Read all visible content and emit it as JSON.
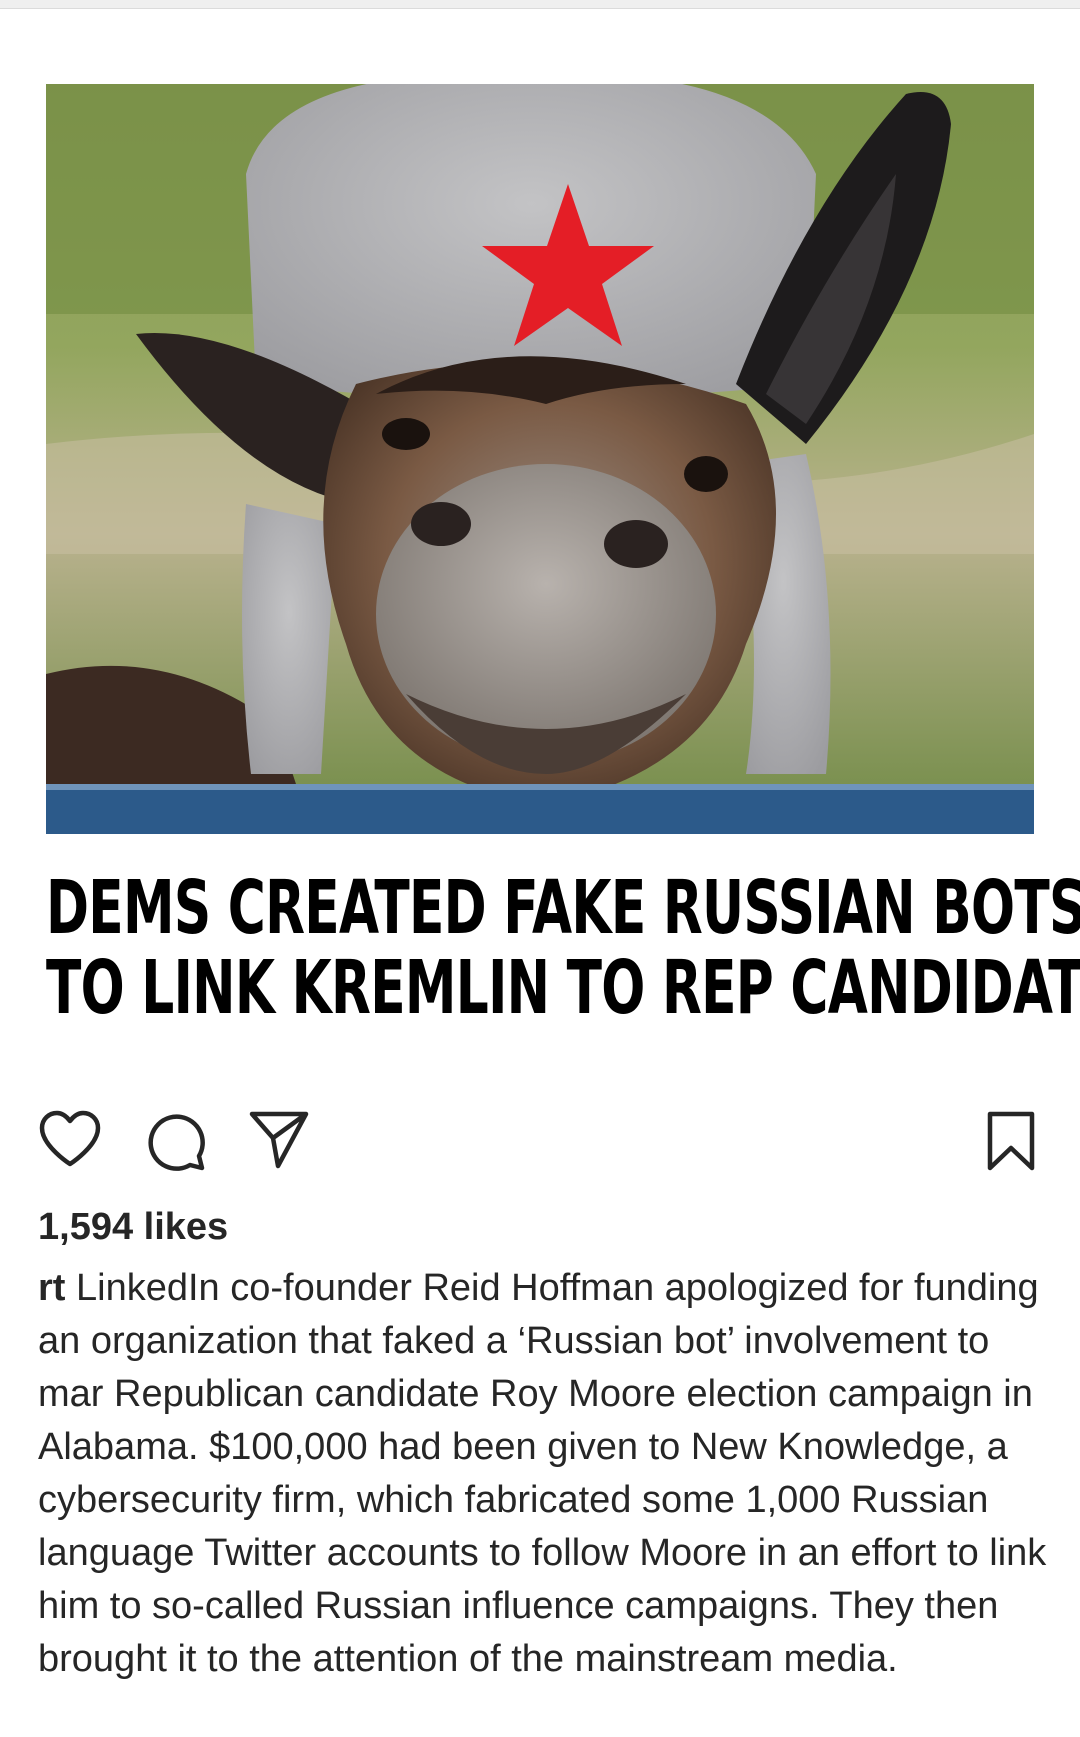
{
  "post": {
    "headline_line1": "DEMS CREATED FAKE RUSSIAN BOTS",
    "headline_line2": "TO LINK KREMLIN TO REP CANDIDATE",
    "image": {
      "description_icon": "donkey-with-soviet-hat-photo",
      "star_color": "#e41e26"
    }
  },
  "actions": {
    "like_icon": "heart-icon",
    "comment_icon": "comment-icon",
    "share_icon": "paper-plane-icon",
    "save_icon": "bookmark-icon"
  },
  "likes": "1,594 likes",
  "caption": {
    "username": "rt",
    "text": " LinkedIn co-founder Reid Hoffman apologized for funding an organization that faked a ‘Russian bot’ involvement to mar Republican candidate Roy Moore election campaign in Alabama. $100,000 had been given to New Knowledge, a cybersecurity firm, which fabricated some 1,000 Russian language Twitter accounts to follow Moore in an effort to link him to so-called Russian influence campaigns. They then brought it to the attention of the mainstream media."
  }
}
